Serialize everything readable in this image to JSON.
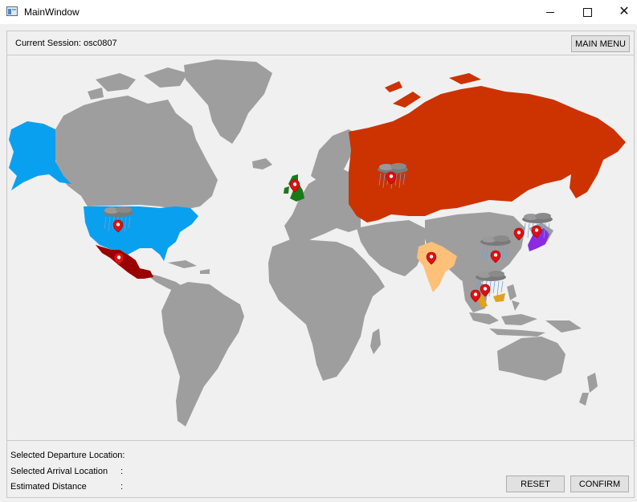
{
  "window": {
    "title": "MainWindow",
    "minimize_glyph": "minimize",
    "maximize_glyph": "maximize",
    "close_glyph": "✕"
  },
  "header": {
    "session_label": "Current Session: osc0807",
    "main_menu_label": "MAIN MENU"
  },
  "map": {
    "land_color": "#9e9e9e",
    "highlighted_countries": [
      {
        "name": "Alaska",
        "color": "#0aa0f0"
      },
      {
        "name": "United States",
        "color": "#0aa0f0"
      },
      {
        "name": "Mexico",
        "color": "#990000"
      },
      {
        "name": "United Kingdom",
        "color": "#1a7a1a"
      },
      {
        "name": "Russia",
        "color": "#cc3300"
      },
      {
        "name": "India",
        "color": "#ffc07a"
      },
      {
        "name": "Japan",
        "color": "#8a2be2"
      },
      {
        "name": "Malaysia",
        "color": "#e0a020"
      }
    ],
    "pin_icon": "map-pin-icon",
    "weather_icon": "rain-cloud-icon"
  },
  "footer": {
    "departure_label": "Selected Departure Location:",
    "arrival_label": "Selected Arrival Location",
    "arrival_colon": ":",
    "distance_label": "Estimated Distance",
    "distance_colon": ":",
    "reset_label": "RESET",
    "confirm_label": "CONFIRM"
  }
}
